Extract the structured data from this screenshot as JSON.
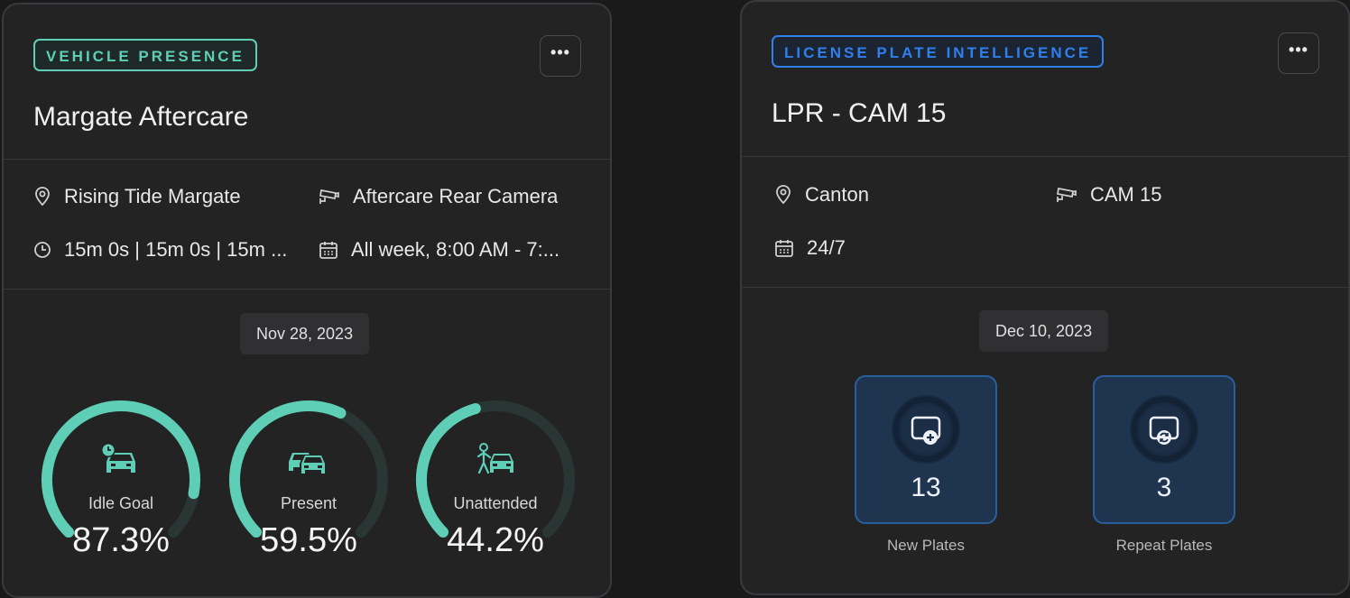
{
  "left_card": {
    "badge": "VEHICLE PRESENCE",
    "more_label": "•••",
    "title": "Margate Aftercare",
    "location": "Rising Tide Margate",
    "camera": "Aftercare Rear Camera",
    "durations": "15m 0s | 15m 0s | 15m ...",
    "schedule": "All week, 8:00 AM - 7:...",
    "date": "Nov 28, 2023",
    "gauges": [
      {
        "label": "Idle Goal",
        "value_text": "87.3%",
        "value": 87.3,
        "icon": "car-clock-icon"
      },
      {
        "label": "Present",
        "value_text": "59.5%",
        "value": 59.5,
        "icon": "two-cars-icon"
      },
      {
        "label": "Unattended",
        "value_text": "44.2%",
        "value": 44.2,
        "icon": "person-car-icon"
      }
    ]
  },
  "right_card": {
    "badge": "LICENSE PLATE INTELLIGENCE",
    "more_label": "•••",
    "title": "LPR - CAM 15",
    "location": "Canton",
    "camera": "CAM 15",
    "schedule": "24/7",
    "date": "Dec 10, 2023",
    "tiles": [
      {
        "value": "13",
        "label": "New Plates",
        "icon": "new-plate-icon"
      },
      {
        "value": "3",
        "label": "Repeat Plates",
        "icon": "repeat-plate-icon"
      }
    ]
  },
  "colors": {
    "teal": "#5ecfb6",
    "teal_track": "#2a3634",
    "blue": "#2f80ed",
    "tile_bg": "#1f344f"
  }
}
